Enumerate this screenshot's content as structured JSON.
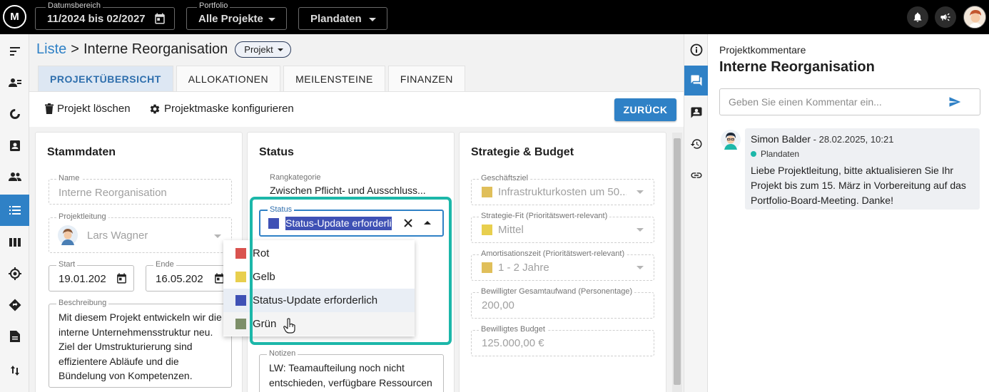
{
  "topbar": {
    "logo_text": "M",
    "date_range": {
      "label": "Datumsbereich",
      "value": "11/2024 bis 02/2027"
    },
    "portfolio": {
      "label": "Portfolio",
      "value": "Alle Projekte"
    },
    "data_type": {
      "value": "Plandaten"
    }
  },
  "breadcrumb": {
    "parent": "Liste",
    "separator": ">",
    "title": "Interne Reorganisation",
    "type_chip": "Projekt"
  },
  "tabs": [
    {
      "label": "PROJEKTÜBERSICHT"
    },
    {
      "label": "ALLOKATIONEN"
    },
    {
      "label": "MEILENSTEINE"
    },
    {
      "label": "FINANZEN"
    }
  ],
  "toolbar": {
    "delete_label": "Projekt löschen",
    "configure_label": "Projektmaske konfigurieren",
    "back_label": "ZURÜCK"
  },
  "stammdaten": {
    "title": "Stammdaten",
    "name": {
      "label": "Name",
      "value": "Interne Reorganisation"
    },
    "lead": {
      "label": "Projektleitung",
      "value": "Lars Wagner"
    },
    "start": {
      "label": "Start",
      "value": "19.01.202"
    },
    "end": {
      "label": "Ende",
      "value": "16.05.202"
    },
    "description": {
      "label": "Beschreibung",
      "value": "Mit diesem Projekt entwickeln wir die interne Unternehmensstruktur neu. Ziel der Umstrukturierung sind effizientere Abläufe und die Bündelung von Kompetenzen."
    }
  },
  "status": {
    "title": "Status",
    "rank": {
      "label": "Rangkategorie",
      "value": "Zwischen Pflicht- und Ausschluss..."
    },
    "status_field": {
      "label": "Status",
      "value": "Status-Update erforderlich",
      "color": "#3f51b5"
    },
    "options": [
      {
        "label": "Rot",
        "color": "#d9534f"
      },
      {
        "label": "Gelb",
        "color": "#e8cf4e"
      },
      {
        "label": "Status-Update erforderlich",
        "color": "#3f51b5"
      },
      {
        "label": "Grün",
        "color": "#7d8f69"
      }
    ],
    "notes": {
      "label": "Notizen",
      "value": "LW: Teamaufteilung noch nicht entschieden, verfügbare Ressourcen prüfen."
    }
  },
  "strategie": {
    "title": "Strategie & Budget",
    "goal": {
      "label": "Geschäftsziel",
      "value": "Infrastrukturkosten um 50...",
      "color": "#e0bf5a"
    },
    "fit": {
      "label": "Strategie-Fit (Prioritätswert-relevant)",
      "value": "Mittel",
      "color": "#e8cf4e"
    },
    "payback": {
      "label": "Amortisationszeit (Prioritätswert-relevant)",
      "value": "1 - 2 Jahre",
      "color": "#e0bf5a"
    },
    "effort": {
      "label": "Bewilligter Gesamtaufwand (Personentage)",
      "value": "200,00"
    },
    "budget": {
      "label": "Bewilligtes Budget",
      "value": "125.000,00 €"
    }
  },
  "comments": {
    "subtitle": "Projektkommentare",
    "project_title": "Interne Reorganisation",
    "input_placeholder": "Geben Sie einen Kommentar ein...",
    "items": [
      {
        "author": "Simon Balder",
        "date": " - 28.02.2025, 10:21",
        "tag": "Plandaten",
        "text": "Liebe Projektleitung, bitte aktualisieren Sie Ihr Projekt bis zum 15. März in Vorbereitung auf das Portfolio-Board-Meeting. Danke!"
      }
    ]
  },
  "colors": {
    "accent": "#2f81c6",
    "highlight": "#1cb7a9"
  }
}
